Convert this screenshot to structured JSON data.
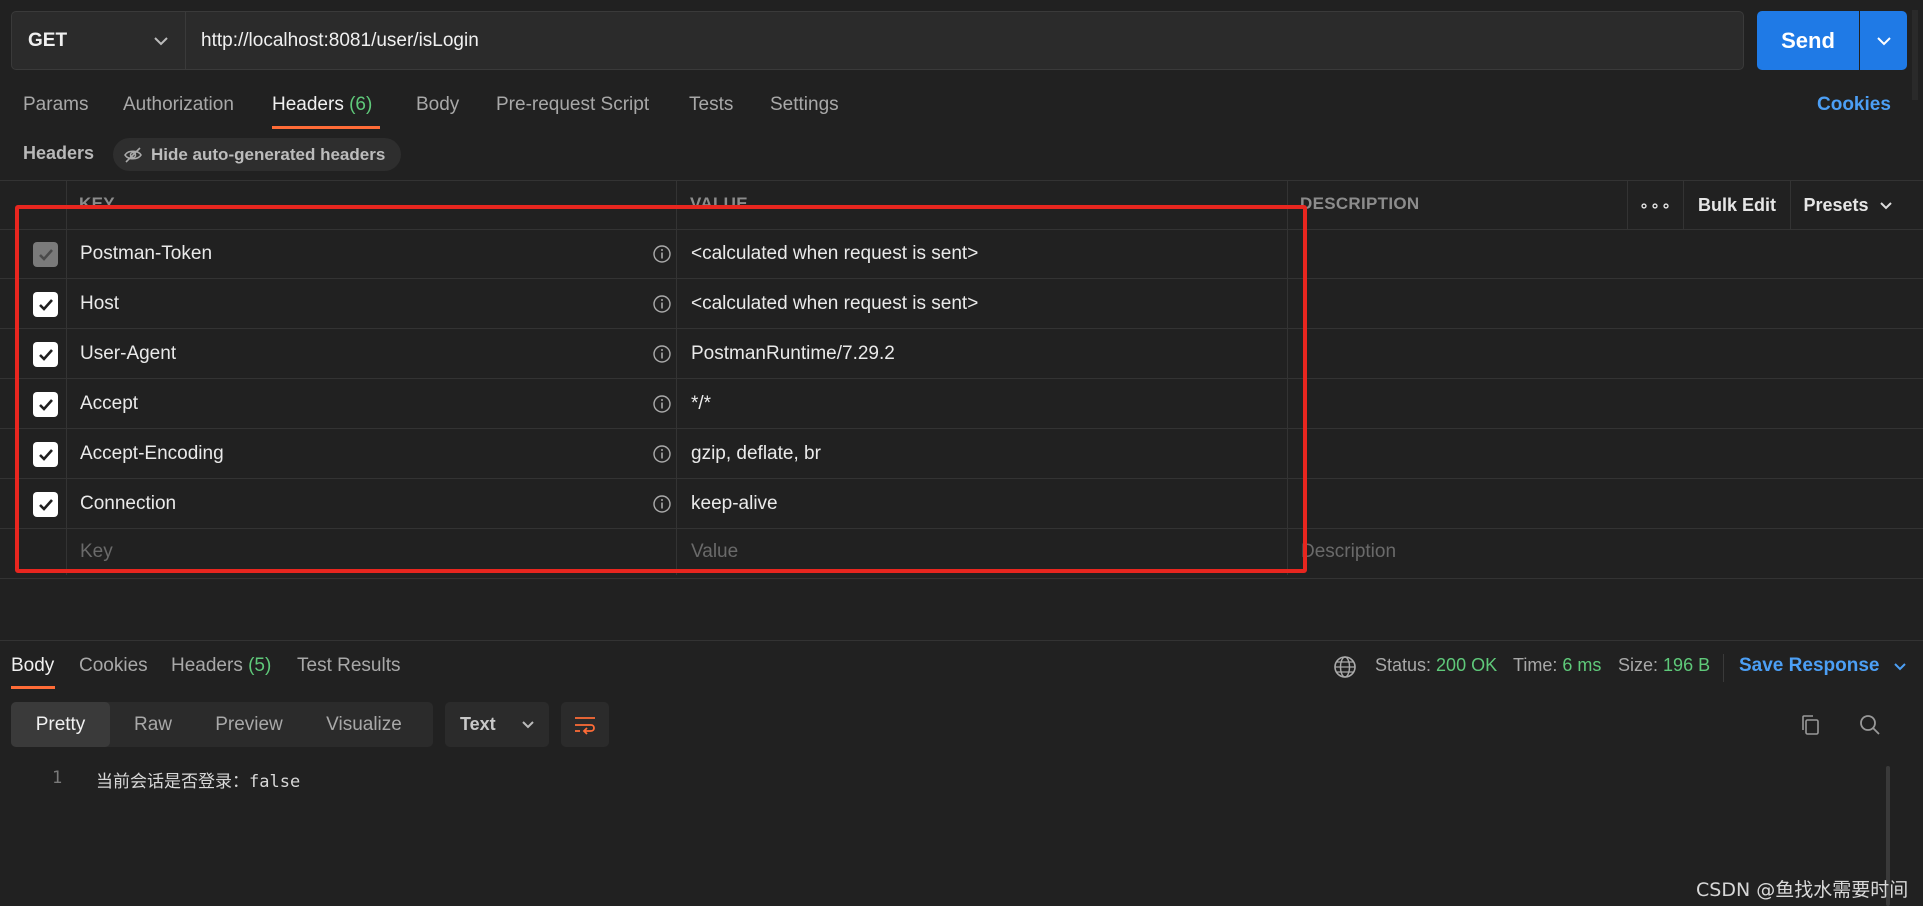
{
  "request": {
    "method": "GET",
    "url": "http://localhost:8081/user/isLogin",
    "send_label": "Send"
  },
  "request_tabs": [
    {
      "label": "Params"
    },
    {
      "label": "Authorization"
    },
    {
      "label": "Headers",
      "count": "(6)"
    },
    {
      "label": "Body"
    },
    {
      "label": "Pre-request Script"
    },
    {
      "label": "Tests"
    },
    {
      "label": "Settings"
    }
  ],
  "active_request_tab": "Headers",
  "cookies_label": "Cookies",
  "headers_section": {
    "title": "Headers",
    "hide_auto_label": "Hide auto-generated headers"
  },
  "table": {
    "columns": {
      "key": "KEY",
      "value": "VALUE",
      "description": "DESCRIPTION"
    },
    "more_label": "∘∘∘",
    "bulk_edit_label": "Bulk Edit",
    "presets_label": "Presets",
    "rows": [
      {
        "key": "Postman-Token",
        "value": "<calculated when request is sent>",
        "checked": true,
        "disabled": true
      },
      {
        "key": "Host",
        "value": "<calculated when request is sent>",
        "checked": true,
        "disabled": false
      },
      {
        "key": "User-Agent",
        "value": "PostmanRuntime/7.29.2",
        "checked": true,
        "disabled": false
      },
      {
        "key": "Accept",
        "value": "*/*",
        "checked": true,
        "disabled": false
      },
      {
        "key": "Accept-Encoding",
        "value": "gzip, deflate, br",
        "checked": true,
        "disabled": false
      },
      {
        "key": "Connection",
        "value": "keep-alive",
        "checked": true,
        "disabled": false
      }
    ],
    "placeholders": {
      "key": "Key",
      "value": "Value",
      "description": "Description"
    }
  },
  "response_tabs": [
    {
      "label": "Body"
    },
    {
      "label": "Cookies"
    },
    {
      "label": "Headers",
      "count": "(5)"
    },
    {
      "label": "Test Results"
    }
  ],
  "active_response_tab": "Body",
  "response_status": {
    "status_label": "Status:",
    "status_value": "200 OK",
    "time_label": "Time:",
    "time_value": "6 ms",
    "size_label": "Size:",
    "size_value": "196 B",
    "save_label": "Save Response"
  },
  "view_modes": [
    "Pretty",
    "Raw",
    "Preview",
    "Visualize"
  ],
  "active_view_mode": "Pretty",
  "format_select": "Text",
  "response_body": [
    {
      "line": "1",
      "text": "当前会话是否登录：false"
    }
  ],
  "watermark": "CSDN @鱼找水需要时间",
  "colors": {
    "accent_orange": "#ff6c37",
    "send_blue": "#1f7ae6",
    "link_blue": "#4c9ff5",
    "success_green": "#5fc97a",
    "highlight_red": "#e8261f"
  }
}
